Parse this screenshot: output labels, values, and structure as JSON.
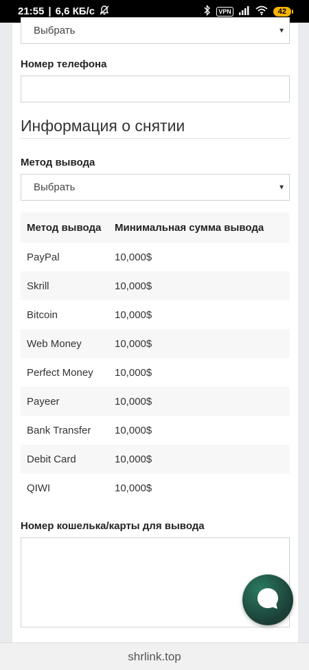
{
  "status_bar": {
    "time": "21:55",
    "speed": "6,6 КБ/с",
    "vpn": "VPN",
    "battery": "42"
  },
  "form": {
    "top_select_value": "Выбрать",
    "phone_label": "Номер телефона",
    "section_title": "Информация о снятии",
    "method_label": "Метод вывода",
    "method_select_value": "Выбрать",
    "wallet_label": "Номер кошелька/карты для вывода"
  },
  "table": {
    "headers": [
      "Метод вывода",
      "Минимальная сумма вывода"
    ],
    "rows": [
      {
        "method": "PayPal",
        "min": "10,000$"
      },
      {
        "method": "Skrill",
        "min": "10,000$"
      },
      {
        "method": "Bitcoin",
        "min": "10,000$"
      },
      {
        "method": "Web Money",
        "min": "10,000$"
      },
      {
        "method": "Perfect Money",
        "min": "10,000$"
      },
      {
        "method": "Payeer",
        "min": "10,000$"
      },
      {
        "method": "Bank Transfer",
        "min": "10,000$"
      },
      {
        "method": "Debit Card",
        "min": "10,000$"
      },
      {
        "method": "QIWI",
        "min": "10,000$"
      }
    ]
  },
  "browser": {
    "url": "shrlink.top"
  }
}
